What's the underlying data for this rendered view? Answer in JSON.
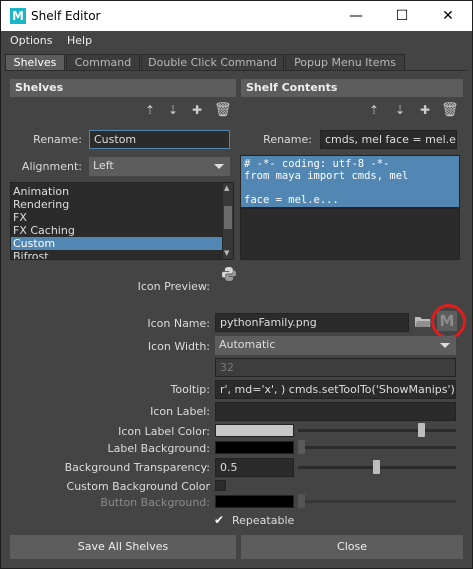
{
  "window": {
    "title": "Shelf Editor",
    "app_icon_letter": "M",
    "minimize": "—",
    "maximize": "☐",
    "close": "✕"
  },
  "menu": [
    "Options",
    "Help"
  ],
  "tabs": [
    "Shelves",
    "Command",
    "Double Click Command",
    "Popup Menu Items"
  ],
  "left": {
    "header": "Shelves",
    "rename_label": "Rename:",
    "rename_value": "Custom",
    "alignment_label": "Alignment:",
    "alignment_value": "Left",
    "shelves": [
      "Animation",
      "Rendering",
      "FX",
      "FX Caching",
      "Custom",
      "Bifrost"
    ],
    "selected": "Custom"
  },
  "right": {
    "header": "Shelf Contents",
    "rename_label": "Rename:",
    "rename_value": "cmds, mel  face = mel.e...",
    "code_lines": [
      "# -*- coding: utf-8 -*-",
      "from maya import cmds, mel",
      "",
      "face = mel.e..."
    ]
  },
  "fields": {
    "icon_preview_label": "Icon Preview:",
    "icon_name_label": "Icon Name:",
    "icon_name_value": "pythonFamily.png",
    "icon_width_label": "Icon Width:",
    "icon_width_value": "Automatic",
    "icon_width_number": "32",
    "tooltip_label": "Tooltip:",
    "tooltip_value": "r',     md='x', ) cmds.setToolTo('ShowManips')",
    "icon_label_label": "Icon Label:",
    "icon_label_value": "",
    "icon_label_color_label": "Icon Label Color:",
    "label_background_label": "Label Background:",
    "bg_transparency_label": "Background Transparency:",
    "bg_transparency_value": "0.5",
    "custom_bg_color_label": "Custom Background Color",
    "button_background_label": "Button Background:",
    "repeatable_label": "Repeatable"
  },
  "buttons": {
    "save_all": "Save All Shelves",
    "close": "Close"
  },
  "colors": {
    "accent": "#5287b4",
    "panel": "#444444",
    "header": "#5d5d5d",
    "field": "#2b2b2b",
    "highlight": "#e01c1c"
  },
  "icons": [
    "move-up-icon",
    "move-down-icon",
    "new-item-icon",
    "delete-icon",
    "folder-icon",
    "maya-logo-icon",
    "python-icon"
  ]
}
